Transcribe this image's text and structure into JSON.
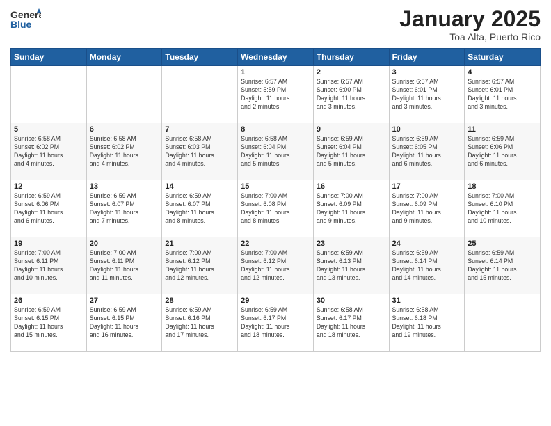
{
  "logo": {
    "general": "General",
    "blue": "Blue"
  },
  "title": "January 2025",
  "subtitle": "Toa Alta, Puerto Rico",
  "days_header": [
    "Sunday",
    "Monday",
    "Tuesday",
    "Wednesday",
    "Thursday",
    "Friday",
    "Saturday"
  ],
  "weeks": [
    [
      {
        "day": "",
        "info": ""
      },
      {
        "day": "",
        "info": ""
      },
      {
        "day": "",
        "info": ""
      },
      {
        "day": "1",
        "info": "Sunrise: 6:57 AM\nSunset: 5:59 PM\nDaylight: 11 hours\nand 2 minutes."
      },
      {
        "day": "2",
        "info": "Sunrise: 6:57 AM\nSunset: 6:00 PM\nDaylight: 11 hours\nand 3 minutes."
      },
      {
        "day": "3",
        "info": "Sunrise: 6:57 AM\nSunset: 6:01 PM\nDaylight: 11 hours\nand 3 minutes."
      },
      {
        "day": "4",
        "info": "Sunrise: 6:57 AM\nSunset: 6:01 PM\nDaylight: 11 hours\nand 3 minutes."
      }
    ],
    [
      {
        "day": "5",
        "info": "Sunrise: 6:58 AM\nSunset: 6:02 PM\nDaylight: 11 hours\nand 4 minutes."
      },
      {
        "day": "6",
        "info": "Sunrise: 6:58 AM\nSunset: 6:02 PM\nDaylight: 11 hours\nand 4 minutes."
      },
      {
        "day": "7",
        "info": "Sunrise: 6:58 AM\nSunset: 6:03 PM\nDaylight: 11 hours\nand 4 minutes."
      },
      {
        "day": "8",
        "info": "Sunrise: 6:58 AM\nSunset: 6:04 PM\nDaylight: 11 hours\nand 5 minutes."
      },
      {
        "day": "9",
        "info": "Sunrise: 6:59 AM\nSunset: 6:04 PM\nDaylight: 11 hours\nand 5 minutes."
      },
      {
        "day": "10",
        "info": "Sunrise: 6:59 AM\nSunset: 6:05 PM\nDaylight: 11 hours\nand 6 minutes."
      },
      {
        "day": "11",
        "info": "Sunrise: 6:59 AM\nSunset: 6:06 PM\nDaylight: 11 hours\nand 6 minutes."
      }
    ],
    [
      {
        "day": "12",
        "info": "Sunrise: 6:59 AM\nSunset: 6:06 PM\nDaylight: 11 hours\nand 6 minutes."
      },
      {
        "day": "13",
        "info": "Sunrise: 6:59 AM\nSunset: 6:07 PM\nDaylight: 11 hours\nand 7 minutes."
      },
      {
        "day": "14",
        "info": "Sunrise: 6:59 AM\nSunset: 6:07 PM\nDaylight: 11 hours\nand 8 minutes."
      },
      {
        "day": "15",
        "info": "Sunrise: 7:00 AM\nSunset: 6:08 PM\nDaylight: 11 hours\nand 8 minutes."
      },
      {
        "day": "16",
        "info": "Sunrise: 7:00 AM\nSunset: 6:09 PM\nDaylight: 11 hours\nand 9 minutes."
      },
      {
        "day": "17",
        "info": "Sunrise: 7:00 AM\nSunset: 6:09 PM\nDaylight: 11 hours\nand 9 minutes."
      },
      {
        "day": "18",
        "info": "Sunrise: 7:00 AM\nSunset: 6:10 PM\nDaylight: 11 hours\nand 10 minutes."
      }
    ],
    [
      {
        "day": "19",
        "info": "Sunrise: 7:00 AM\nSunset: 6:11 PM\nDaylight: 11 hours\nand 10 minutes."
      },
      {
        "day": "20",
        "info": "Sunrise: 7:00 AM\nSunset: 6:11 PM\nDaylight: 11 hours\nand 11 minutes."
      },
      {
        "day": "21",
        "info": "Sunrise: 7:00 AM\nSunset: 6:12 PM\nDaylight: 11 hours\nand 12 minutes."
      },
      {
        "day": "22",
        "info": "Sunrise: 7:00 AM\nSunset: 6:12 PM\nDaylight: 11 hours\nand 12 minutes."
      },
      {
        "day": "23",
        "info": "Sunrise: 6:59 AM\nSunset: 6:13 PM\nDaylight: 11 hours\nand 13 minutes."
      },
      {
        "day": "24",
        "info": "Sunrise: 6:59 AM\nSunset: 6:14 PM\nDaylight: 11 hours\nand 14 minutes."
      },
      {
        "day": "25",
        "info": "Sunrise: 6:59 AM\nSunset: 6:14 PM\nDaylight: 11 hours\nand 15 minutes."
      }
    ],
    [
      {
        "day": "26",
        "info": "Sunrise: 6:59 AM\nSunset: 6:15 PM\nDaylight: 11 hours\nand 15 minutes."
      },
      {
        "day": "27",
        "info": "Sunrise: 6:59 AM\nSunset: 6:15 PM\nDaylight: 11 hours\nand 16 minutes."
      },
      {
        "day": "28",
        "info": "Sunrise: 6:59 AM\nSunset: 6:16 PM\nDaylight: 11 hours\nand 17 minutes."
      },
      {
        "day": "29",
        "info": "Sunrise: 6:59 AM\nSunset: 6:17 PM\nDaylight: 11 hours\nand 18 minutes."
      },
      {
        "day": "30",
        "info": "Sunrise: 6:58 AM\nSunset: 6:17 PM\nDaylight: 11 hours\nand 18 minutes."
      },
      {
        "day": "31",
        "info": "Sunrise: 6:58 AM\nSunset: 6:18 PM\nDaylight: 11 hours\nand 19 minutes."
      },
      {
        "day": "",
        "info": ""
      }
    ]
  ]
}
